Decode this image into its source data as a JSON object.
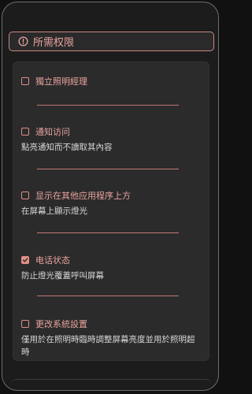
{
  "header": {
    "title": "所需权限",
    "icon": "alert-circle-icon"
  },
  "permissions": [
    {
      "label": "獨立照明經理",
      "description": "",
      "checked": false
    },
    {
      "label": "通知访问",
      "description": "點亮通知而不讀取其內容",
      "checked": false
    },
    {
      "label": "显示在其他应用程序上方",
      "description": "在屏幕上顯示燈光",
      "checked": false
    },
    {
      "label": "电话状态",
      "description": "防止燈光覆蓋呼叫屏幕",
      "checked": true
    },
    {
      "label": "更改系統設置",
      "description": "僅用於在照明時臨時調整屏幕亮度並用於照明超時",
      "checked": false
    }
  ],
  "colors": {
    "accent": "#e08f88",
    "background": "#1c1c1c",
    "card": "#2b2b2b"
  }
}
